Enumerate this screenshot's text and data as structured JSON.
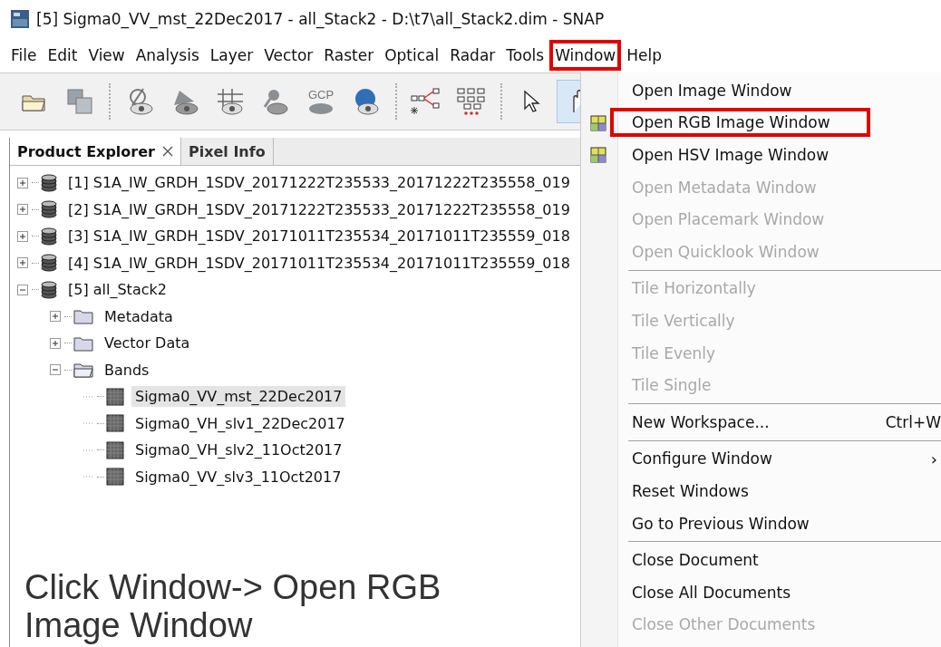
{
  "window": {
    "title": "[5] Sigma0_VV_mst_22Dec2017 - all_Stack2 - D:\\t7\\all_Stack2.dim - SNAP"
  },
  "menu_bar": [
    {
      "label": "File",
      "highlighted": false
    },
    {
      "label": "Edit",
      "highlighted": false
    },
    {
      "label": "View",
      "highlighted": false
    },
    {
      "label": "Analysis",
      "highlighted": false
    },
    {
      "label": "Layer",
      "highlighted": false
    },
    {
      "label": "Vector",
      "highlighted": false
    },
    {
      "label": "Raster",
      "highlighted": false
    },
    {
      "label": "Optical",
      "highlighted": false
    },
    {
      "label": "Radar",
      "highlighted": false
    },
    {
      "label": "Tools",
      "highlighted": false
    },
    {
      "label": "Window",
      "highlighted": true
    },
    {
      "label": "Help",
      "highlighted": false
    }
  ],
  "toolbar": [
    {
      "kind": "open",
      "selected": false
    },
    {
      "kind": "copy",
      "selected": false
    },
    {
      "kind": "separator"
    },
    {
      "kind": "eye-slash",
      "selected": false
    },
    {
      "kind": "eye-mask",
      "selected": false
    },
    {
      "kind": "eye-grid",
      "selected": false
    },
    {
      "kind": "eye-pin",
      "selected": false
    },
    {
      "kind": "gcp",
      "label": "GCP",
      "selected": false
    },
    {
      "kind": "eye-globe",
      "selected": false
    },
    {
      "kind": "separator"
    },
    {
      "kind": "graph",
      "selected": false
    },
    {
      "kind": "batch",
      "selected": false
    },
    {
      "kind": "separator"
    },
    {
      "kind": "pointer",
      "selected": false
    },
    {
      "kind": "hand",
      "selected": true
    }
  ],
  "panel_tabs": [
    {
      "label": "Product Explorer",
      "closable": true,
      "selected": true
    },
    {
      "label": "Pixel Info",
      "closable": false,
      "selected": false
    }
  ],
  "tree": [
    {
      "label": "[1] S1A_IW_GRDH_1SDV_20171222T235533_20171222T235558_019",
      "kind": "product",
      "expanded": false,
      "selected": false
    },
    {
      "label": "[2] S1A_IW_GRDH_1SDV_20171222T235533_20171222T235558_019",
      "kind": "product",
      "expanded": false,
      "selected": false
    },
    {
      "label": "[3] S1A_IW_GRDH_1SDV_20171011T235534_20171011T235559_018",
      "kind": "product",
      "expanded": false,
      "selected": false
    },
    {
      "label": "[4] S1A_IW_GRDH_1SDV_20171011T235534_20171011T235559_018",
      "kind": "product",
      "expanded": false,
      "selected": false
    },
    {
      "label": "[5] all_Stack2",
      "kind": "product",
      "expanded": true,
      "selected": false,
      "children": [
        {
          "label": "Metadata",
          "kind": "folder",
          "expanded": false,
          "selected": false
        },
        {
          "label": "Vector Data",
          "kind": "folder",
          "expanded": false,
          "selected": false
        },
        {
          "label": "Bands",
          "kind": "folder",
          "expanded": true,
          "selected": false,
          "children": [
            {
              "label": "Sigma0_VV_mst_22Dec2017",
              "kind": "band",
              "selected": true
            },
            {
              "label": "Sigma0_VH_slv1_22Dec2017",
              "kind": "band",
              "selected": false
            },
            {
              "label": "Sigma0_VH_slv2_11Oct2017",
              "kind": "band",
              "selected": false
            },
            {
              "label": "Sigma0_VV_slv3_11Oct2017",
              "kind": "band",
              "selected": false
            }
          ]
        }
      ]
    }
  ],
  "caption": "Click Window-> Open RGB Image Window",
  "window_menu": [
    {
      "kind": "item",
      "label": "Open Image Window",
      "disabled": false,
      "highlighted": false,
      "icon": false
    },
    {
      "kind": "item",
      "label": "Open RGB Image Window",
      "disabled": false,
      "highlighted": true,
      "icon": true
    },
    {
      "kind": "item",
      "label": "Open HSV Image Window",
      "disabled": false,
      "highlighted": false,
      "icon": true
    },
    {
      "kind": "item",
      "label": "Open Metadata Window",
      "disabled": true,
      "highlighted": false,
      "icon": false
    },
    {
      "kind": "item",
      "label": "Open Placemark Window",
      "disabled": true,
      "highlighted": false,
      "icon": false
    },
    {
      "kind": "item",
      "label": "Open Quicklook Window",
      "disabled": true,
      "highlighted": false,
      "icon": false
    },
    {
      "kind": "separator"
    },
    {
      "kind": "item",
      "label": "Tile Horizontally",
      "disabled": true,
      "highlighted": false,
      "icon": false
    },
    {
      "kind": "item",
      "label": "Tile Vertically",
      "disabled": true,
      "highlighted": false,
      "icon": false
    },
    {
      "kind": "item",
      "label": "Tile Evenly",
      "disabled": true,
      "highlighted": false,
      "icon": false
    },
    {
      "kind": "item",
      "label": "Tile Single",
      "disabled": true,
      "highlighted": false,
      "icon": false
    },
    {
      "kind": "separator"
    },
    {
      "kind": "item",
      "label": "New Workspace...",
      "disabled": false,
      "highlighted": false,
      "icon": false,
      "shortcut": "Ctrl+W"
    },
    {
      "kind": "separator"
    },
    {
      "kind": "item",
      "label": "Configure Window",
      "disabled": false,
      "highlighted": false,
      "icon": false,
      "submenu": "›"
    },
    {
      "kind": "item",
      "label": "Reset Windows",
      "disabled": false,
      "highlighted": false,
      "icon": false
    },
    {
      "kind": "item",
      "label": "Go to Previous Window",
      "disabled": false,
      "highlighted": false,
      "icon": false
    },
    {
      "kind": "separator"
    },
    {
      "kind": "item",
      "label": "Close Document",
      "disabled": false,
      "highlighted": false,
      "icon": false
    },
    {
      "kind": "item",
      "label": "Close All Documents",
      "disabled": false,
      "highlighted": false,
      "icon": false
    },
    {
      "kind": "item",
      "label": "Close Other Documents",
      "disabled": true,
      "highlighted": false,
      "icon": false
    }
  ]
}
